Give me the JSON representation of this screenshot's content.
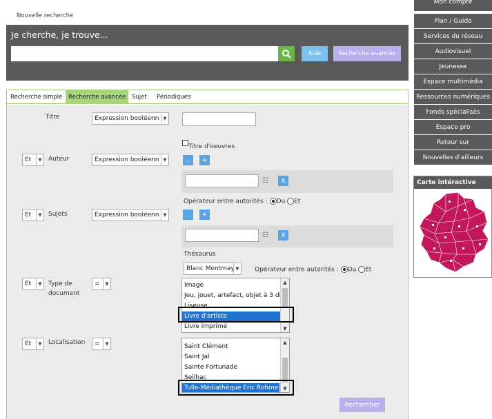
{
  "top_tab": "Nouvelle recherche",
  "search": {
    "title": "Je cherche, je trouve...",
    "value": "",
    "aide_label": "Aide",
    "advanced_label": "Recherche avancée"
  },
  "tabs": [
    "Recherche simple",
    "Recherche avancée",
    "Sujet",
    "Périodiques"
  ],
  "form": {
    "titre_label": "Titre",
    "titre_mode": "Expression booléenn",
    "titre_oeuvres_label": "Titre d'oeuvres",
    "auteur_op": "Et",
    "auteur_label": "Auteur",
    "auteur_mode": "Expression booléenn",
    "dots_label": "...",
    "plus_label": "+",
    "x_label": "X",
    "operateur_label": "Opérateur entre autorités :",
    "ou_label": "Ou",
    "et_label": "Et",
    "sujets_op": "Et",
    "sujets_label": "Sujets",
    "sujets_mode": "Expression booléenn",
    "thesaurus_label": "Thésaurus",
    "thesaurus_value": "Blanc Montmay",
    "type_op": "Et",
    "type_label_1": "Type de",
    "type_label_2": "document",
    "type_cmp": "=",
    "type_options": [
      "Image",
      "Jeu, jouet, artefact, objet à 3 di",
      "Liseuse",
      "Livre d'artiste",
      "Livre imprimé"
    ],
    "loc_op": "Et",
    "loc_label": "Localisation",
    "loc_cmp": "=",
    "loc_options": [
      "Saint Clément",
      "Saint Jal",
      "Sainte Fortunade",
      "Seilhac",
      "Tulle-Médiathèque Eric Rohme"
    ],
    "submit_label": "Rechercher"
  },
  "nav": {
    "top_partial": "Mon compte",
    "items": [
      "Plan / Guide",
      "Services du réseau",
      "Audiovisuel",
      "Jeunesse",
      "Espace multimédia",
      "Ressources numériques",
      "Fonds spécialisés",
      "Espace pro",
      "Retour sur",
      "Nouvelles d'ailleurs"
    ]
  },
  "map": {
    "title": "Carte intéractive"
  },
  "colors": {
    "panel": "#5a5a5a",
    "accent_green": "#6ab44a",
    "tab_active": "#a7d67a",
    "selection": "#1e74d0",
    "map_fill": "#c2185b"
  }
}
